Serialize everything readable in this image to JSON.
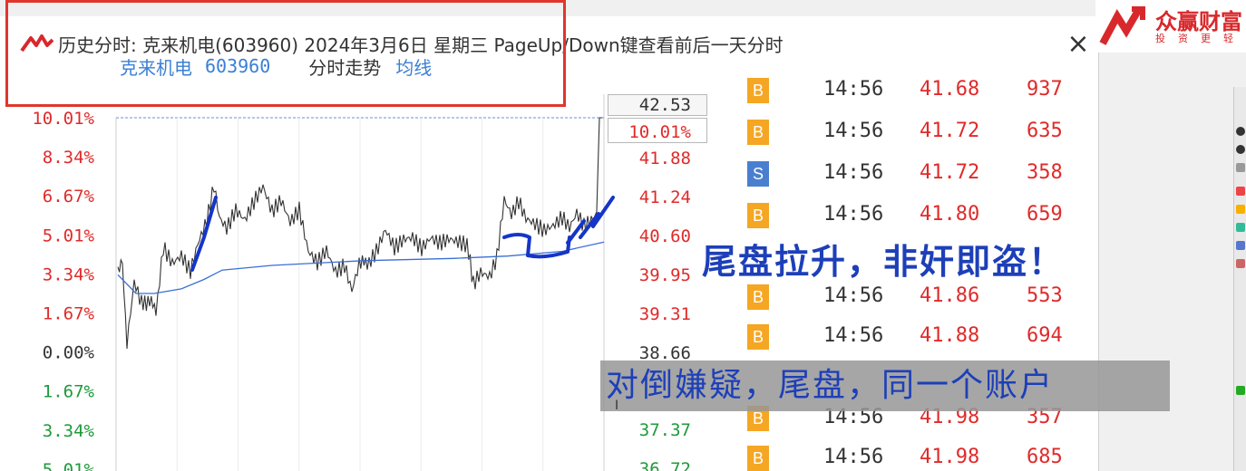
{
  "window": {
    "title": "历史分时: 克来机电(603960) 2024年3月6日 星期三 PageUp/Down键查看前后一天分时",
    "close_glyph": "×"
  },
  "subbar": {
    "name": "克来机电",
    "code": "603960",
    "trend_label": "分时走势",
    "ma_label": "均线"
  },
  "chart": {
    "left_axis": [
      "10.01%",
      "8.34%",
      "6.67%",
      "5.01%",
      "3.34%",
      "1.67%",
      "0.00%",
      "1.67%",
      "3.34%",
      "5.01%"
    ],
    "left_axis_colors": [
      "red",
      "red",
      "red",
      "red",
      "red",
      "red",
      "dark",
      "green",
      "green",
      "green"
    ],
    "right_axis": [
      "42.53",
      "10.01%",
      "41.88",
      "41.24",
      "40.60",
      "39.95",
      "39.31",
      "38.66",
      "37.37",
      "36.72"
    ],
    "right_axis_colors": [
      "dark",
      "red",
      "red",
      "red",
      "red",
      "red",
      "red",
      "dark",
      "green",
      "green"
    ],
    "price_color": "#333333",
    "avg_color": "#3a6fd6",
    "annotation_color": "#1535c8"
  },
  "trades": [
    {
      "side": "B",
      "time": "14:56",
      "price": "41.68",
      "volume": "937"
    },
    {
      "side": "B",
      "time": "14:56",
      "price": "41.72",
      "volume": "635"
    },
    {
      "side": "S",
      "time": "14:56",
      "price": "41.72",
      "volume": "358"
    },
    {
      "side": "B",
      "time": "14:56",
      "price": "41.80",
      "volume": "659"
    },
    {
      "side": "B",
      "time": "14:56",
      "price": "41.86",
      "volume": "553"
    },
    {
      "side": "B",
      "time": "14:56",
      "price": "41.88",
      "volume": "694"
    },
    {
      "side": "B",
      "time": "14:56",
      "price": "41.98",
      "volume": "357"
    },
    {
      "side": "B",
      "time": "14:56",
      "price": "41.98",
      "volume": "685"
    }
  ],
  "captions": {
    "top": "尾盘拉升，非奸即盗！",
    "bottom": "对倒嫌疑，尾盘，同一个账户"
  },
  "brand": {
    "name": "众赢财富",
    "sub": "投资更轻"
  },
  "colors": {
    "up": "#e02a2a",
    "down": "#1f9a3a",
    "neutral": "#333333",
    "highlight": "#e0362b"
  }
}
